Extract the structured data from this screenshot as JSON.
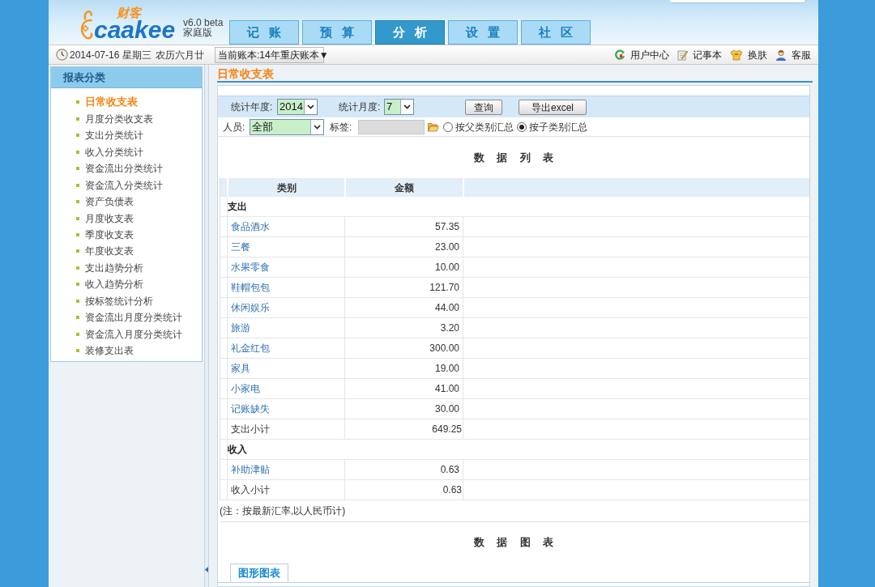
{
  "header": {
    "logo": {
      "mark": "财客",
      "wordmark": "caakee"
    },
    "version": "v6.0 beta",
    "edition": "家庭版",
    "tabs": [
      {
        "label": "记 账",
        "selected": false
      },
      {
        "label": "预 算",
        "selected": false
      },
      {
        "label": "分 析",
        "selected": true
      },
      {
        "label": "设 置",
        "selected": false
      },
      {
        "label": "社 区",
        "selected": false
      }
    ]
  },
  "info_bar": {
    "date": "2014-07-16 星期三",
    "lunar_date": "农历六月廿",
    "account_book": "当前账本:14年重庆账本▼",
    "links": [
      {
        "kind": "refresh",
        "label": "用户中心"
      },
      {
        "kind": "notepad",
        "label": "记事本"
      },
      {
        "kind": "shirt",
        "label": "换肤"
      },
      {
        "kind": "person",
        "label": "客服"
      }
    ]
  },
  "sidebar": {
    "title": "报表分类",
    "items": [
      {
        "label": "日常收支表",
        "selected": true
      },
      {
        "label": "月度分类收支表",
        "selected": false
      },
      {
        "label": "支出分类统计",
        "selected": false
      },
      {
        "label": "收入分类统计",
        "selected": false
      },
      {
        "label": "资金流出分类统计",
        "selected": false
      },
      {
        "label": "资金流入分类统计",
        "selected": false
      },
      {
        "label": "资产负债表",
        "selected": false
      },
      {
        "label": "月度收支表",
        "selected": false
      },
      {
        "label": "季度收支表",
        "selected": false
      },
      {
        "label": "年度收支表",
        "selected": false
      },
      {
        "label": "支出趋势分析",
        "selected": false
      },
      {
        "label": "收入趋势分析",
        "selected": false
      },
      {
        "label": "按标签统计分析",
        "selected": false
      },
      {
        "label": "资金流出月度分类统计",
        "selected": false
      },
      {
        "label": "资金流入月度分类统计",
        "selected": false
      },
      {
        "label": "装修支出表",
        "selected": false
      }
    ]
  },
  "report": {
    "title": "日常收支表",
    "filters": {
      "year_label": "统计年度:",
      "year": "2014",
      "month_label": "统计月度:",
      "month": "7",
      "buttons": [
        "查询",
        "导出excel"
      ],
      "person_label": "人员:",
      "person": "全部",
      "tag_label": "标签:",
      "tag_field": {
        "disabled": true
      },
      "grouping": [
        {
          "label": "按父类别汇总",
          "selected": false
        },
        {
          "label": "按子类别汇总",
          "selected": true
        }
      ]
    },
    "list_heading": "数 据 列 表",
    "table": {
      "columns": [
        "类别",
        "金额"
      ],
      "rows": [
        {
          "kind": "section",
          "category": "支出"
        },
        {
          "kind": "item",
          "category": "食品酒水",
          "amount": "57.35"
        },
        {
          "kind": "item",
          "category": "三餐",
          "amount": "23.00"
        },
        {
          "kind": "item",
          "category": "水果零食",
          "amount": "10.00"
        },
        {
          "kind": "item",
          "category": "鞋帽包包",
          "amount": "121.70"
        },
        {
          "kind": "item",
          "category": "休闲娱乐",
          "amount": "44.00"
        },
        {
          "kind": "item",
          "category": "旅游",
          "amount": "3.20"
        },
        {
          "kind": "item",
          "category": "礼金红包",
          "amount": "300.00"
        },
        {
          "kind": "item",
          "category": "家具",
          "amount": "19.00"
        },
        {
          "kind": "item",
          "category": "小家电",
          "amount": "41.00"
        },
        {
          "kind": "item",
          "category": "记账缺失",
          "amount": "30.00"
        },
        {
          "kind": "subtotal",
          "category": "支出小计",
          "amount": "649.25"
        },
        {
          "kind": "section",
          "category": "收入"
        },
        {
          "kind": "item",
          "category": "补助津贴",
          "amount": "0.63"
        },
        {
          "kind": "subtotal",
          "category": "收入小计",
          "amount": "0.63"
        }
      ]
    },
    "note": "(注：按最新汇率,以人民币计)",
    "chart_heading": "数 据 图 表",
    "chart_tabs": [
      {
        "label": "图形图表",
        "selected": true
      }
    ]
  }
}
